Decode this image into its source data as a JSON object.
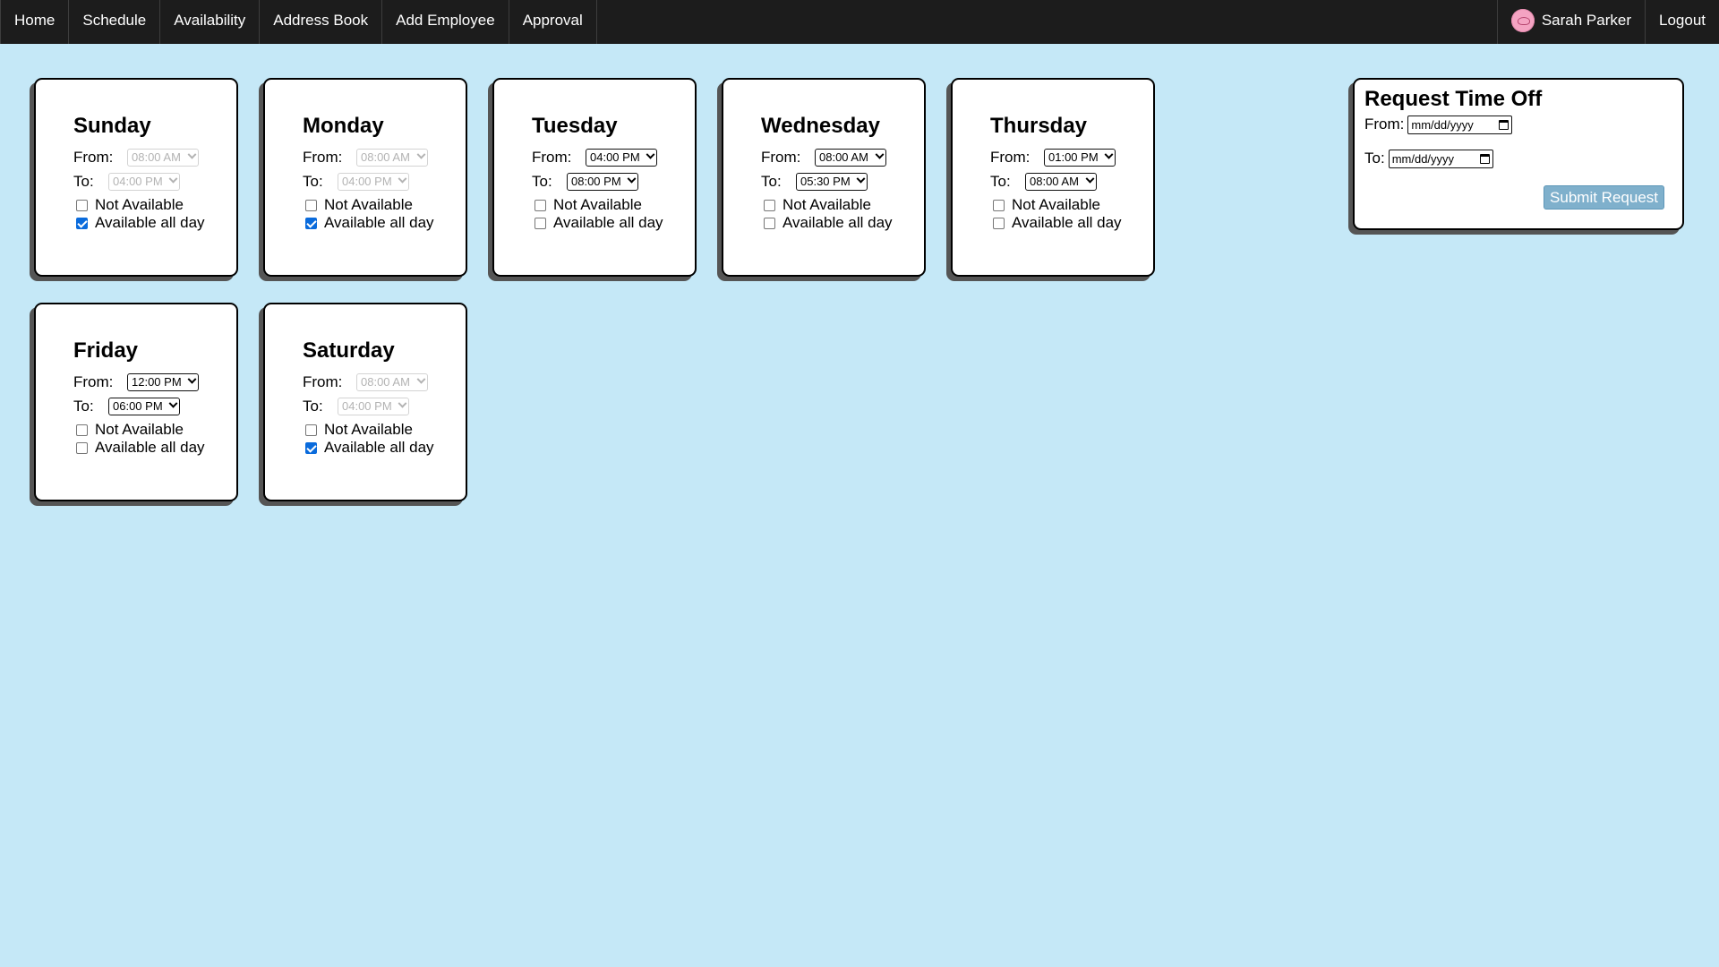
{
  "nav": {
    "items": [
      "Home",
      "Schedule",
      "Availability",
      "Address Book",
      "Add Employee",
      "Approval"
    ],
    "user_name": "Sarah Parker",
    "logout": "Logout"
  },
  "labels": {
    "from": "From:",
    "to": "To:",
    "not_available": "Not Available",
    "available_all_day": "Available all day"
  },
  "days": [
    {
      "name": "Sunday",
      "from": "08:00 AM",
      "to": "04:00 PM",
      "not_available": false,
      "all_day": true
    },
    {
      "name": "Monday",
      "from": "08:00 AM",
      "to": "04:00 PM",
      "not_available": false,
      "all_day": true
    },
    {
      "name": "Tuesday",
      "from": "04:00 PM",
      "to": "08:00 PM",
      "not_available": false,
      "all_day": false
    },
    {
      "name": "Wednesday",
      "from": "08:00 AM",
      "to": "05:30 PM",
      "not_available": false,
      "all_day": false
    },
    {
      "name": "Thursday",
      "from": "01:00 PM",
      "to": "08:00 AM",
      "not_available": false,
      "all_day": false
    },
    {
      "name": "Friday",
      "from": "12:00 PM",
      "to": "06:00 PM",
      "not_available": false,
      "all_day": false
    },
    {
      "name": "Saturday",
      "from": "08:00 AM",
      "to": "04:00 PM",
      "not_available": false,
      "all_day": true
    }
  ],
  "time_off": {
    "title": "Request Time Off",
    "from_label": "From:",
    "to_label": "To:",
    "from_placeholder": "mm/dd/yyyy",
    "to_placeholder": "mm/dd/yyyy",
    "submit_label": "Submit Request"
  },
  "colors": {
    "background": "#c5e8f7",
    "nav": "#1c1c1c",
    "checkbox_checked": "#0a6bdc",
    "submit_button": "#7fb0cc"
  }
}
